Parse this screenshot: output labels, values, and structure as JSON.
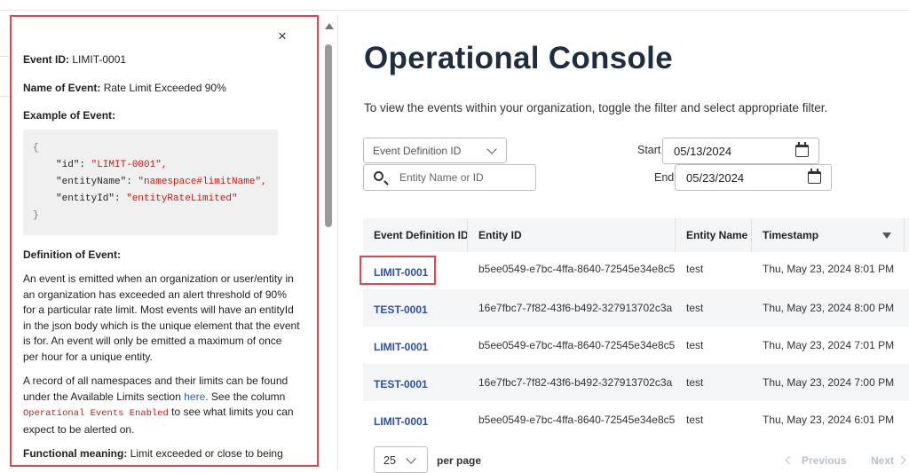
{
  "panel": {
    "close_glyph": "×",
    "event_id_label": "Event ID:",
    "event_id_value": " LIMIT-0001",
    "name_label": "Name of Event:",
    "name_value": " Rate Limit Exceeded 90%",
    "example_label": "Example of Event:",
    "code": {
      "open": "{",
      "id_key": "\"id\": ",
      "id_val": "\"LIMIT-0001\",",
      "name_key": "\"entityName\": ",
      "name_val": "\"namespace#limitName\",",
      "eid_key": "\"entityId\": ",
      "eid_val": "\"entityRateLimited\"",
      "close": "}"
    },
    "definition_label": "Definition of Event:",
    "definition_text": "An event is emitted when an organization or user/entity in an organization has exceeded an alert threshold of 90% for a particular rate limit. Most events will have an entityId in the json body which is the unique element that the event is for. An event will only be emitted a maximum of once per hour for a unique entity.",
    "record_text_1": "A record of all namespaces and their limits can be found under the Available Limits section ",
    "record_link": "here",
    "record_text_2": ". See the column ",
    "record_code": "Operational Events Enabled",
    "record_text_3": " to see what limits you can expect to be alerted on.",
    "functional_label": "Functional meaning:",
    "functional_value": " Limit exceeded or close to being exceeded warning."
  },
  "main": {
    "title": "Operational Console",
    "subtitle": "To view the events within your organization, toggle the filter and select appropriate filter.",
    "filter_select": "Event Definition ID",
    "search_placeholder": "Entity Name or ID",
    "start_label": "Start",
    "start_date": "05/13/2024",
    "end_label": "End",
    "end_date": "05/23/2024"
  },
  "table": {
    "headers": [
      "Event Definition ID",
      "Entity ID",
      "Entity Name",
      "Timestamp"
    ],
    "rows": [
      {
        "id": "LIMIT-0001",
        "entity_id": "b5ee0549-e7bc-4ffa-8640-72545e34e8c5",
        "name": "test",
        "timestamp": "Thu, May 23, 2024 8:01 PM"
      },
      {
        "id": "TEST-0001",
        "entity_id": "16e7fbc7-7f82-43f6-b492-327913702c3a",
        "name": "test",
        "timestamp": "Thu, May 23, 2024 8:00 PM"
      },
      {
        "id": "LIMIT-0001",
        "entity_id": "b5ee0549-e7bc-4ffa-8640-72545e34e8c5",
        "name": "test",
        "timestamp": "Thu, May 23, 2024 7:01 PM"
      },
      {
        "id": "TEST-0001",
        "entity_id": "16e7fbc7-7f82-43f6-b492-327913702c3a",
        "name": "test",
        "timestamp": "Thu, May 23, 2024 7:00 PM"
      },
      {
        "id": "LIMIT-0001",
        "entity_id": "b5ee0549-e7bc-4ffa-8640-72545e34e8c5",
        "name": "test",
        "timestamp": "Thu, May 23, 2024 6:01 PM"
      }
    ]
  },
  "pagination": {
    "page_size": "25",
    "per_page_label": "per page",
    "previous_label": "Previous",
    "next_label": "Next"
  },
  "colors": {
    "highlight": "#e0474c",
    "link": "#2c4fa8",
    "title": "#1f2d3d"
  }
}
